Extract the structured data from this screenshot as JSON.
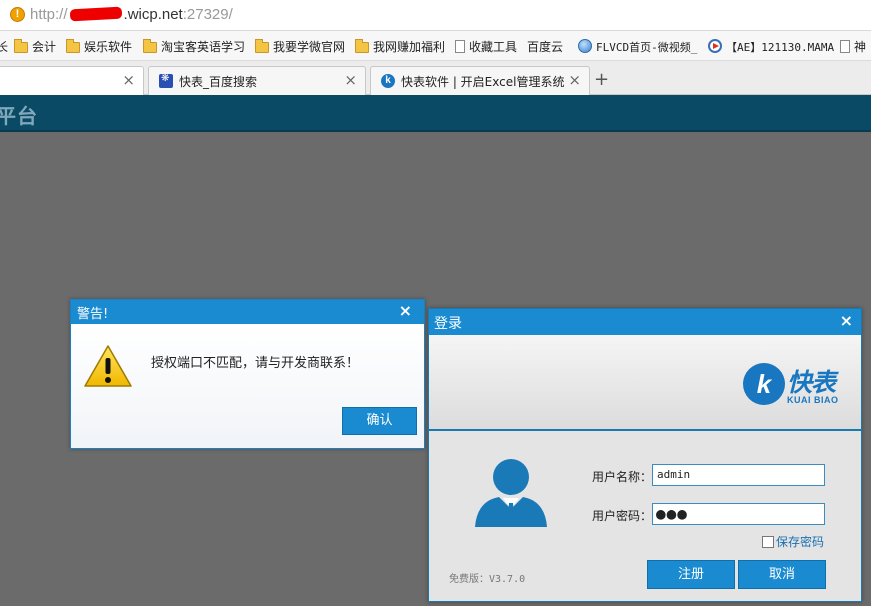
{
  "browser": {
    "address": {
      "url_prefix": "http://",
      "url_host": ".wicp.net",
      "url_port": ":27329/"
    },
    "bookmarks": [
      {
        "label": "长",
        "icon": "none"
      },
      {
        "label": "会计",
        "icon": "folder-icon"
      },
      {
        "label": "娱乐软件",
        "icon": "folder-icon"
      },
      {
        "label": "淘宝客英语学习",
        "icon": "folder-icon"
      },
      {
        "label": "我要学微官网",
        "icon": "folder-icon"
      },
      {
        "label": "我网赚加福利",
        "icon": "folder-icon"
      },
      {
        "label": "收藏工具",
        "icon": "page-icon"
      },
      {
        "label": "百度云",
        "icon": "none"
      },
      {
        "label": "FLVCD首页-微视频_",
        "icon": "globe-icon"
      },
      {
        "label": "【AE】121130.MAMA",
        "icon": "play-icon"
      },
      {
        "label": "神",
        "icon": "page-icon"
      }
    ],
    "tabs": [
      {
        "label": "",
        "close": "×"
      },
      {
        "label": "快表_百度搜索",
        "close": "×"
      },
      {
        "label": "快表软件 | 开启Excel管理系统",
        "close": "×"
      }
    ],
    "new_tab": "+"
  },
  "app": {
    "brand": "平台"
  },
  "warning_dialog": {
    "title": "警告!",
    "close": "×",
    "message": "授权端口不匹配，请与开发商联系！",
    "ok_label": "确认"
  },
  "login_dialog": {
    "title": "登录",
    "close": "×",
    "logo": {
      "mark": "k",
      "cn": "快表",
      "en": "KUAI BIAO"
    },
    "username_label": "用户名称：",
    "username_value": "admin",
    "password_label": "用户密码：",
    "password_value": "●●●",
    "save_password_label": "保存密码",
    "version": "免费版：V3.7.0",
    "register_label": "注册",
    "cancel_label": "取消"
  },
  "colors": {
    "accent": "#1a8bd0",
    "header": "#0a4a64",
    "logo": "#1976c0"
  }
}
